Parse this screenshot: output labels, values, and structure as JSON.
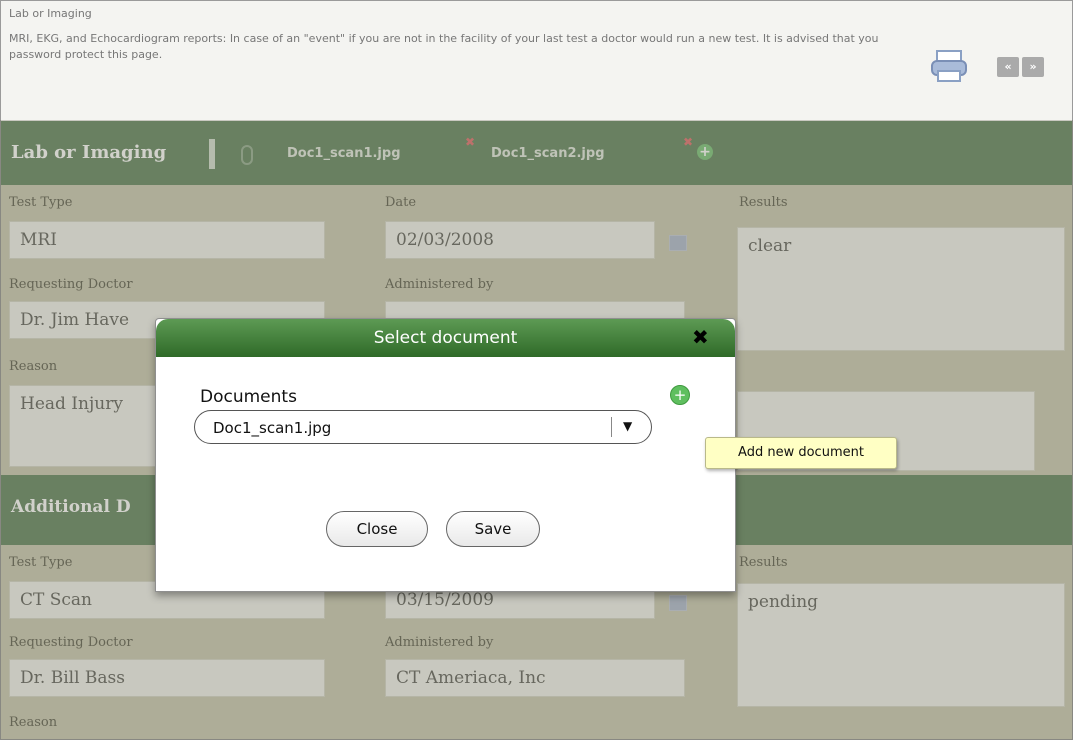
{
  "header": {
    "breadcrumb": "Lab or Imaging",
    "description": "MRI, EKG, and Echocardiogram reports: In case of an \"event\" if you are not in the facility of your last test a doctor would run a new test. It is advised that you password protect this page.",
    "print_icon": "printer-icon",
    "prev_label": "«",
    "next_label": "»"
  },
  "section1": {
    "title": "Lab or Imaging",
    "attachments": [
      "Doc1_scan1.jpg",
      "Doc1_scan2.jpg"
    ],
    "remove_mark": "✖",
    "add_mark": "+",
    "labels": {
      "test_type": "Test Type",
      "date": "Date",
      "results": "Results",
      "requesting_doctor": "Requesting Doctor",
      "administered_by": "Administered by",
      "reason": "Reason"
    },
    "values": {
      "test_type": "MRI",
      "date": "02/03/2008",
      "results": "clear",
      "requesting_doctor": "Dr. Jim Have",
      "administered_by": "",
      "reason": "Head Injury"
    }
  },
  "section2": {
    "title": "Additional D",
    "labels": {
      "test_type": "Test Type",
      "results": "Results",
      "requesting_doctor": "Requesting Doctor",
      "administered_by": "Administered by",
      "reason": "Reason"
    },
    "values": {
      "test_type": "CT Scan",
      "date": "03/15/2009",
      "results": "pending",
      "requesting_doctor": "Dr. Bill Bass",
      "administered_by": "CT Ameriaca, Inc"
    }
  },
  "modal": {
    "title": "Select document",
    "close_icon": "✖",
    "documents_label": "Documents",
    "selected_document": "Doc1_scan1.jpg",
    "dropdown_arrow": "▼",
    "add_icon": "+",
    "tooltip": "Add new document",
    "close_button": "Close",
    "save_button": "Save"
  },
  "colors": {
    "section_bar": "#6f8f6c",
    "panel": "#cfcdb9",
    "modal_header": "#3f7f37"
  }
}
